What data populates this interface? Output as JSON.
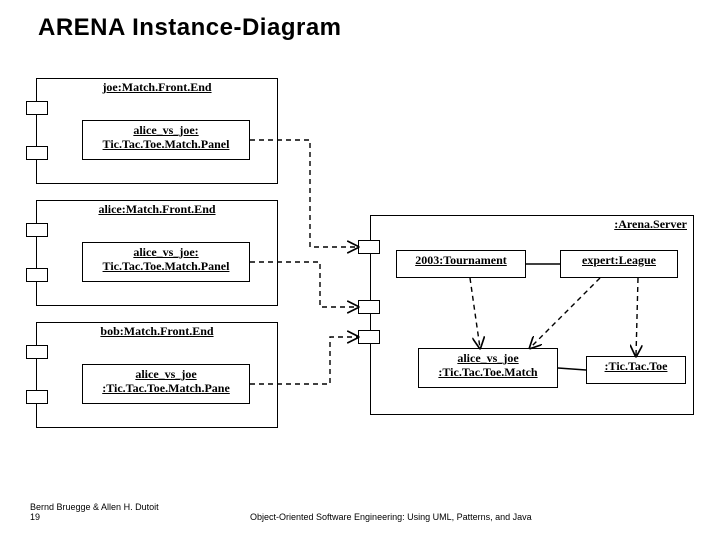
{
  "title": "ARENA Instance-Diagram",
  "footer_left": "Bernd Bruegge & Allen H. Dutoit",
  "footer_page": "19",
  "footer_center": "Object-Oriented Software Engineering: Using UML, Patterns, and Java",
  "containers": {
    "joe_frontend": "joe:Match.Front.End",
    "alice_frontend": "alice:Match.Front.End",
    "bob_frontend": "bob:Match.Front.End",
    "arena_server": ":Arena.Server"
  },
  "inner_panels": {
    "joe_panel_l1": "alice_vs_joe:",
    "joe_panel_l2": "Tic.Tac.Toe.Match.Panel",
    "alice_panel_l1": "alice_vs_joe:",
    "alice_panel_l2": "Tic.Tac.Toe.Match.Panel",
    "bob_panel_l1": "alice_vs_joe",
    "bob_panel_l2": ":Tic.Tac.Toe.Match.Pane"
  },
  "server_instances": {
    "tournament": "2003:Tournament",
    "league": "expert:League",
    "match_l1": "alice_vs_joe",
    "match_l2": ":Tic.Tac.Toe.Match",
    "ttt": ":Tic.Tac.Toe"
  }
}
